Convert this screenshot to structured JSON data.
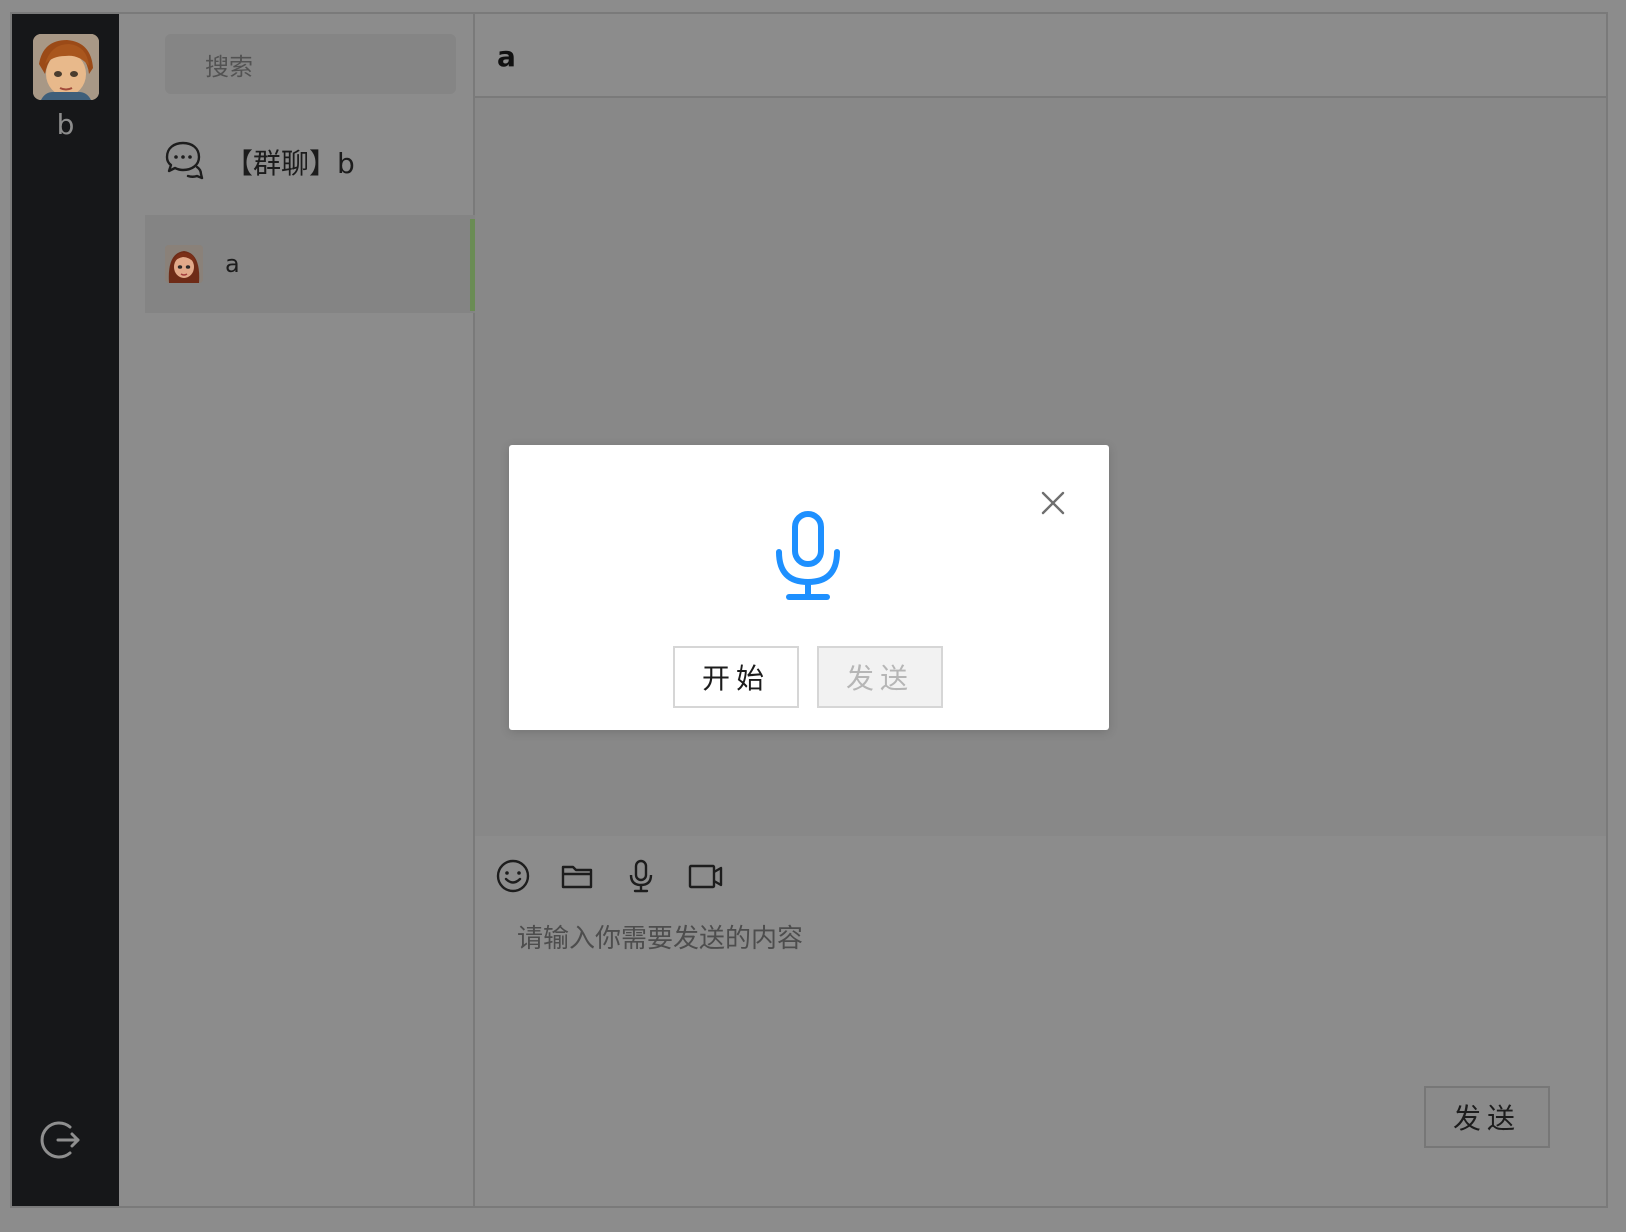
{
  "user": {
    "name": "b"
  },
  "search": {
    "placeholder": "搜索"
  },
  "conversations": [
    {
      "name": "【群聊】b",
      "type": "group"
    },
    {
      "name": "a",
      "type": "user",
      "selected": true
    }
  ],
  "chat": {
    "title": "a",
    "input_placeholder": "请输入你需要发送的内容",
    "send_label": "发送"
  },
  "toolbar": {
    "icons": [
      "emoji-icon",
      "folder-icon",
      "microphone-icon",
      "video-icon"
    ]
  },
  "voice_modal": {
    "start_label": "开始",
    "send_label": "发送"
  },
  "colors": {
    "accent": "#1e90ff",
    "active_bar": "#6a8c54",
    "rail": "#161719"
  }
}
